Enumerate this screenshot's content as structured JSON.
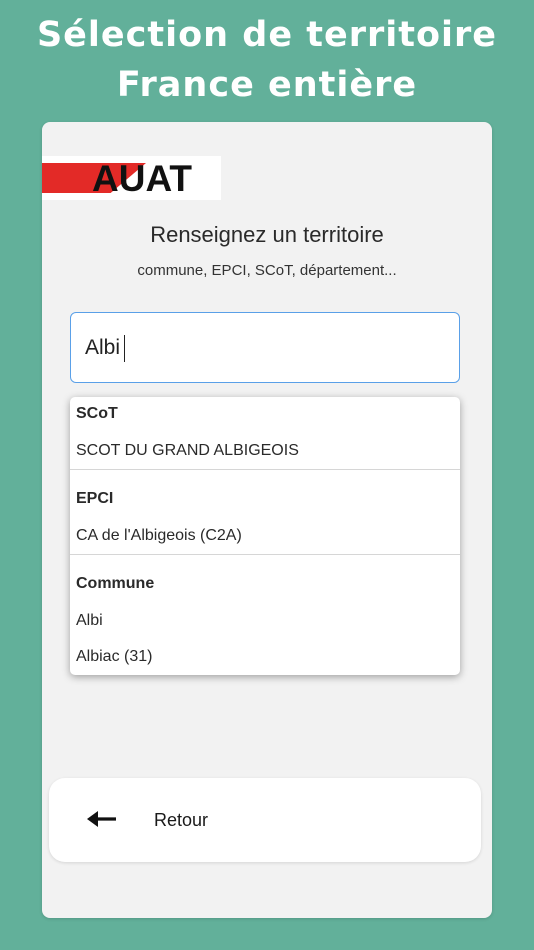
{
  "header": {
    "title_line1": "Sélection de territoire",
    "title_line2": "France entière"
  },
  "logo": {
    "text": "AUAT",
    "bar_color": "#e32a27"
  },
  "prompt": {
    "title": "Renseignez un territoire",
    "subtitle": "commune, EPCI, SCoT, département..."
  },
  "search": {
    "value": "Albi",
    "border_color": "#5aa0e8"
  },
  "results": {
    "groups": [
      {
        "title": "SCoT",
        "items": [
          "SCOT DU GRAND ALBIGEOIS"
        ]
      },
      {
        "title": "EPCI",
        "items": [
          "CA de l'Albigeois (C2A)"
        ]
      },
      {
        "title": "Commune",
        "items": [
          "Albi",
          "Albiac (31)"
        ]
      }
    ]
  },
  "back": {
    "label": "Retour",
    "icon": "arrow-left-icon"
  },
  "colors": {
    "background": "#62b09a",
    "card": "#f2f2f2"
  }
}
